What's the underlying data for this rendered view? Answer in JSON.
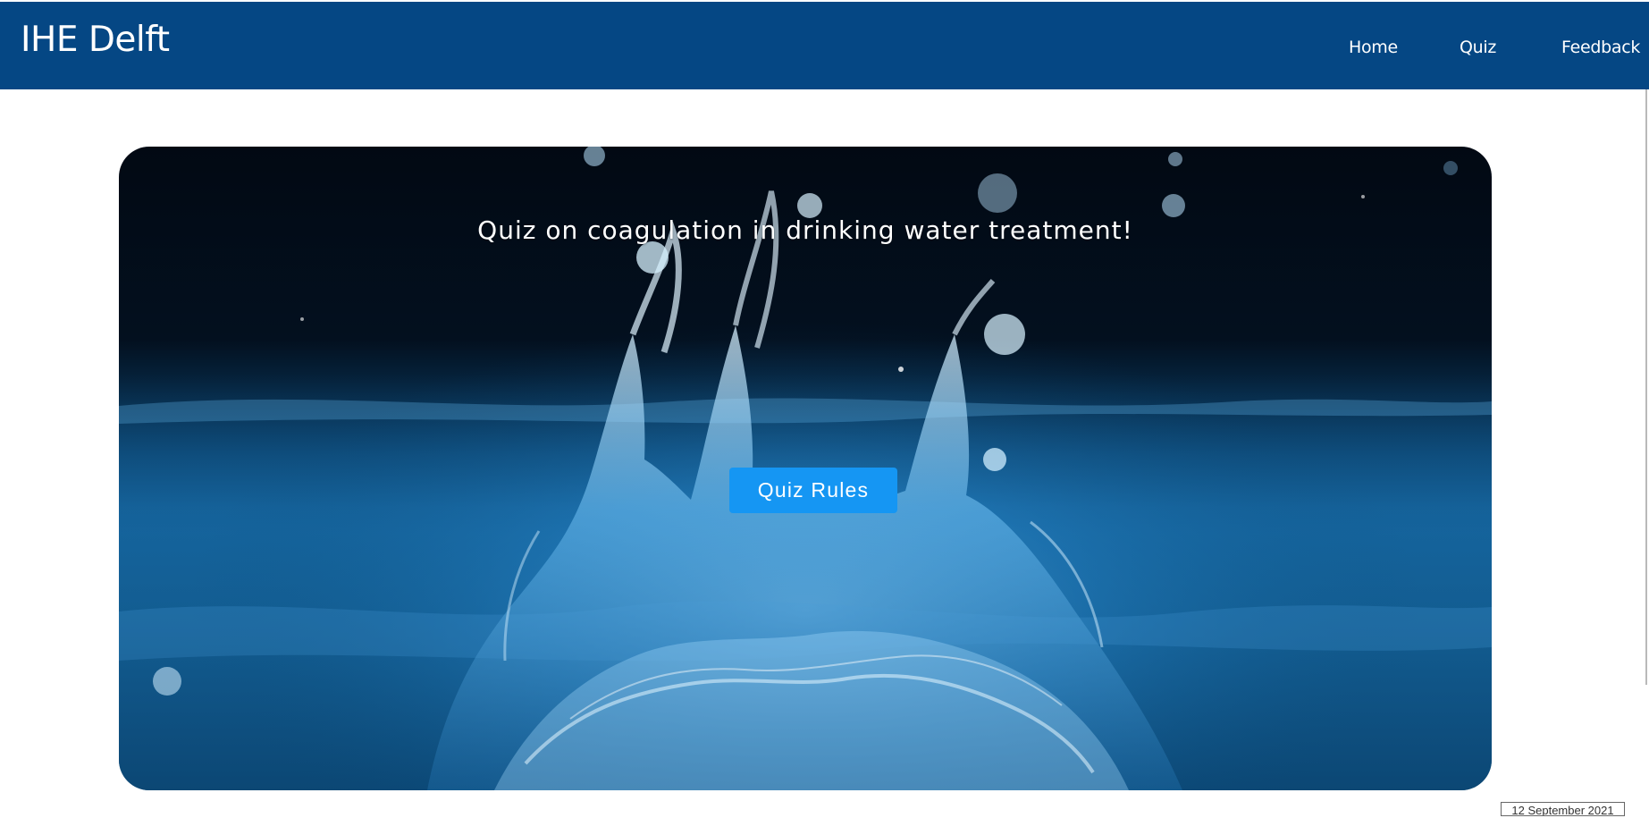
{
  "navbar": {
    "brand": "IHE Delft",
    "links": [
      "Home",
      "Quiz",
      "Feedback"
    ]
  },
  "hero": {
    "title": "Quiz on coagulation in drinking water treatment!",
    "button_label": "Quiz Rules"
  },
  "footer": {
    "date": "12 September 2021"
  },
  "colors": {
    "navbar_background": "#054784",
    "button_background": "#1596f3",
    "text_on_dark": "#ffffff"
  }
}
